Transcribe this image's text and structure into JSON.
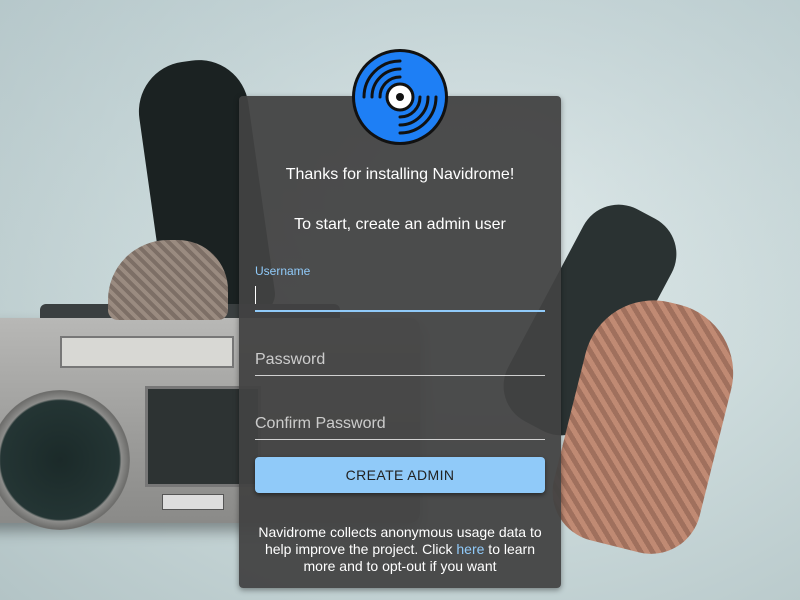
{
  "app": {
    "name": "Navidrome"
  },
  "colors": {
    "accent": "#90caf9",
    "card": "#424242",
    "logo_blue": "#1e7ff5"
  },
  "logo": {
    "icon": "vinyl-record-icon"
  },
  "card": {
    "greeting": "Thanks for installing Navidrome!",
    "instruction": "To start, create an admin user"
  },
  "form": {
    "username": {
      "label": "Username",
      "value": ""
    },
    "password": {
      "placeholder": "Password",
      "value": ""
    },
    "confirm_password": {
      "placeholder": "Confirm Password",
      "value": ""
    },
    "submit_label": "CREATE ADMIN"
  },
  "notice": {
    "before": "Navidrome collects anonymous usage data to help improve the project. Click ",
    "link": "here",
    "after": " to learn more and to opt-out if you want"
  }
}
